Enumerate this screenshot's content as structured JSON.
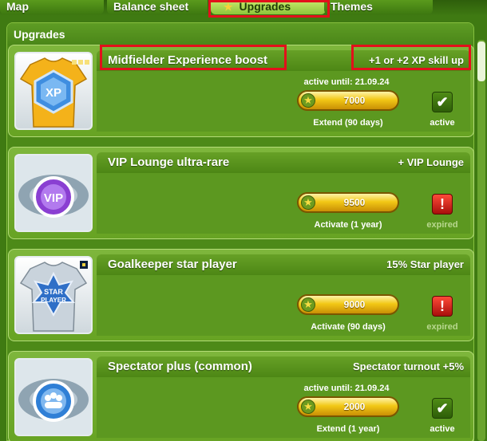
{
  "tabs": [
    {
      "label": "Map"
    },
    {
      "label": "Balance sheet"
    },
    {
      "label": "Upgrades",
      "icon": "star-icon",
      "active": true
    },
    {
      "label": "Themes"
    }
  ],
  "panel": {
    "title": "Upgrades"
  },
  "upgrades": [
    {
      "name": "Midfielder Experience boost",
      "effect": "+1 or +2 XP skill up",
      "active_until": "active until: 21.09.24",
      "price": "7000",
      "action": "Extend (90 days)",
      "status": "active",
      "icon": "xp-jersey-icon"
    },
    {
      "name": "VIP Lounge ultra-rare",
      "effect": "+ VIP Lounge",
      "active_until": "",
      "price": "9500",
      "action": "Activate (1 year)",
      "status": "expired",
      "icon": "vip-stadium-icon"
    },
    {
      "name": "Goalkeeper star player",
      "effect": "15% Star player",
      "active_until": "",
      "price": "9000",
      "action": "Activate (90 days)",
      "status": "expired",
      "icon": "star-player-jersey-icon"
    },
    {
      "name": "Spectator plus (common)",
      "effect": "Spectator turnout +5%",
      "active_until": "active until: 21.09.24",
      "price": "2000",
      "action": "Extend (1 year)",
      "status": "active",
      "icon": "spectator-stadium-icon"
    }
  ],
  "colors": {
    "highlight": "#e3101b",
    "coin": "#f2c816",
    "panel": "#4d8a18"
  }
}
